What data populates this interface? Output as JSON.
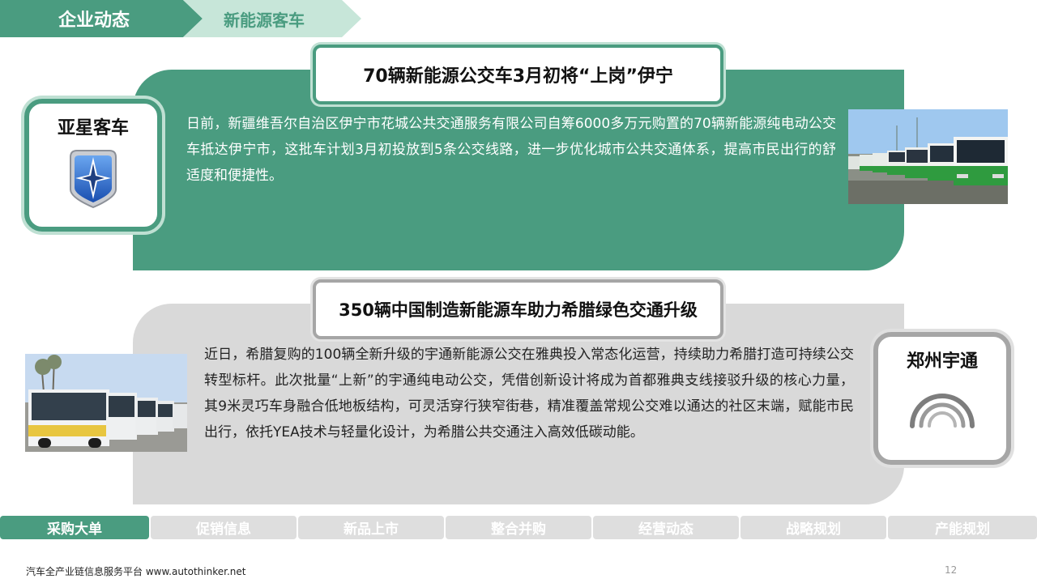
{
  "header": {
    "section": "企业动态",
    "subsection": "新能源客车"
  },
  "stories": [
    {
      "title": "70辆新能源公交车3月初将“上岗”伊宁",
      "brand": "亚星客车",
      "brand_icon": "yaxing-star-logo-icon",
      "body": "日前，新疆维吾尔自治区伊宁市花城公共交通服务有限公司自筹6000多万元购置的70辆新能源纯电动公交车抵达伊宁市，这批车计划3月初投放到5条公交线路，进一步优化城市公共交通体系，提高市民出行的舒适度和便捷性。",
      "photo": "green-buses-photo"
    },
    {
      "title": "350辆中国制造新能源车助力希腊绿色交通升级",
      "brand": "郑州宇通",
      "brand_icon": "yutong-arcs-logo-icon",
      "body": "近日，希腊复购的100辆全新升级的宇通新能源公交在雅典投入常态化运营，持续助力希腊打造可持续公交转型标杆。此次批量“上新”的宇通纯电动公交，凭借创新设计将成为首都雅典支线接驳升级的核心力量， 其9米灵巧车身融合低地板结构，可灵活穿行狭窄街巷，精准覆盖常规公交难以通达的社区末端，赋能市民出行，依托YEA技术与轻量化设计，为希腊公共交通注入高效低碳动能。",
      "photo": "white-buses-photo"
    }
  ],
  "tabs": [
    {
      "label": "采购大单",
      "active": true
    },
    {
      "label": "促销信息",
      "active": false
    },
    {
      "label": "新品上市",
      "active": false
    },
    {
      "label": "整合并购",
      "active": false
    },
    {
      "label": "经营动态",
      "active": false
    },
    {
      "label": "战略规划",
      "active": false
    },
    {
      "label": "产能规划",
      "active": false
    }
  ],
  "footer": {
    "text": "汽车全产业链信息服务平台 www.autothinker.net",
    "page_number": "12"
  },
  "colors": {
    "accent": "#4a9c80",
    "accent_light": "#c7e6d9",
    "gray_panel": "#d9d9d9"
  }
}
